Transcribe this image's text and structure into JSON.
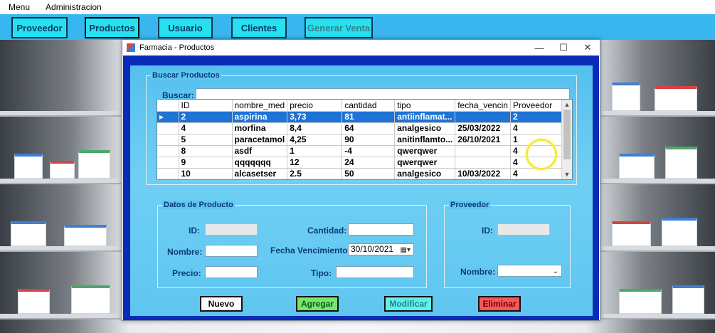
{
  "menu": {
    "items": [
      "Menu",
      "Administracion"
    ]
  },
  "toolbar": {
    "buttons": [
      "Proveedor",
      "Productos",
      "Usuario",
      "Clientes",
      "Generar Venta"
    ]
  },
  "window": {
    "title": "Farmacia - Productos",
    "minimize": "—",
    "maximize": "☐",
    "close": "✕"
  },
  "search": {
    "group_label": "Buscar Productos",
    "label": "Buscar:",
    "value": ""
  },
  "table": {
    "columns": [
      "",
      "ID",
      "nombre_med",
      "precio",
      "cantidad",
      "tipo",
      "fecha_vencin",
      "Proveedor"
    ],
    "rows": [
      {
        "marker": "▸",
        "cells": [
          "2",
          "aspirina",
          "3,73",
          "81",
          "antiinflamat...",
          "",
          "2"
        ]
      },
      {
        "marker": "",
        "cells": [
          "4",
          "morfina",
          "8,4",
          "64",
          "analgesico",
          "25/03/2022",
          "4"
        ]
      },
      {
        "marker": "",
        "cells": [
          "5",
          "paracetamol",
          "4,25",
          "90",
          "anitinflamto...",
          "26/10/2021",
          "1"
        ]
      },
      {
        "marker": "",
        "cells": [
          "8",
          "asdf",
          "1",
          "-4",
          "qwerqwer",
          "",
          "4"
        ]
      },
      {
        "marker": "",
        "cells": [
          "9",
          "qqqqqqq",
          "12",
          "24",
          "qwerqwer",
          "",
          "4"
        ]
      },
      {
        "marker": "",
        "cells": [
          "10",
          "alcasetser",
          "2.5",
          "50",
          "analgesico",
          "10/03/2022",
          "4"
        ]
      }
    ],
    "selected_row": 0
  },
  "product": {
    "group_label": "Datos de Producto",
    "id_label": "ID:",
    "id_value": "",
    "nombre_label": "Nombre:",
    "nombre_value": "",
    "precio_label": "Precio:",
    "precio_value": "",
    "cantidad_label": "Cantidad:",
    "cantidad_value": "",
    "fecha_label": "Fecha Vencimiento:",
    "fecha_value": "30/10/2021",
    "tipo_label": "Tipo:",
    "tipo_value": ""
  },
  "provider": {
    "group_label": "Proveedor",
    "id_label": "ID:",
    "id_value": "",
    "nombre_label": "Nombre:",
    "nombre_value": ""
  },
  "actions": {
    "nuevo": "Nuevo",
    "agregar": "Agregar",
    "modificar": "Modificar",
    "eliminar": "Eliminar"
  },
  "colors": {
    "accent": "#38b6f0",
    "dialog_frame": "#0a2bb8",
    "selection": "#1e73d6",
    "agregar": "#78e56f",
    "modificar": "#5ff0ee",
    "eliminar": "#f25a5a"
  }
}
